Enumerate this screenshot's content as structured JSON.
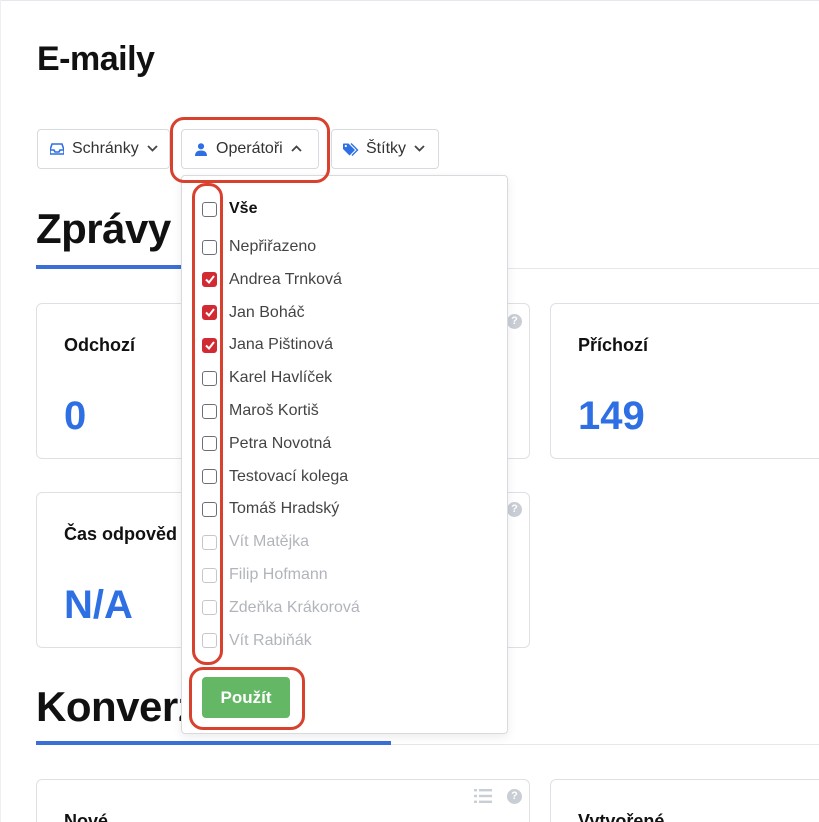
{
  "page": {
    "title": "E-maily"
  },
  "filters": {
    "mailboxes": {
      "label": "Schránky",
      "icon": "inbox-icon"
    },
    "operators": {
      "label": "Operátoři",
      "icon": "user-icon",
      "expanded": true
    },
    "tags": {
      "label": "Štítky",
      "icon": "tags-icon"
    }
  },
  "operators_dropdown": {
    "all_label": "Vše",
    "options": [
      {
        "label": "Nepřiřazeno",
        "checked": false,
        "inactive": false
      },
      {
        "label": "Andrea Trnková",
        "checked": true,
        "inactive": false
      },
      {
        "label": "Jan Boháč",
        "checked": true,
        "inactive": false
      },
      {
        "label": "Jana Pištinová",
        "checked": true,
        "inactive": false
      },
      {
        "label": "Karel Havlíček",
        "checked": false,
        "inactive": false
      },
      {
        "label": "Maroš Kortiš",
        "checked": false,
        "inactive": false
      },
      {
        "label": "Petra Novotná",
        "checked": false,
        "inactive": false
      },
      {
        "label": "Testovací kolega",
        "checked": false,
        "inactive": false
      },
      {
        "label": "Tomáš Hradský",
        "checked": false,
        "inactive": false
      },
      {
        "label": "Vít Matějka",
        "checked": false,
        "inactive": true
      },
      {
        "label": "Filip Hofmann",
        "checked": false,
        "inactive": true
      },
      {
        "label": "Zdeňka Krákorová",
        "checked": false,
        "inactive": true
      },
      {
        "label": "Vít Rabiňák",
        "checked": false,
        "inactive": true
      }
    ],
    "apply_label": "Použít"
  },
  "sections": {
    "messages": {
      "title": "Zprávy",
      "cards": {
        "outgoing": {
          "label": "Odchozí",
          "value": "0"
        },
        "incoming": {
          "label": "Příchozí",
          "value": "149"
        },
        "response_time": {
          "label": "Čas odpověd",
          "value": "N/A"
        }
      }
    },
    "conversations": {
      "title": "Konverz",
      "cards": {
        "new": {
          "label": "Nové"
        },
        "created": {
          "label": "Vytvořené"
        }
      }
    }
  },
  "colors": {
    "accent": "#2f6fe4",
    "checked": "#d12a33",
    "apply": "#64b764",
    "highlight": "#d9412f"
  }
}
